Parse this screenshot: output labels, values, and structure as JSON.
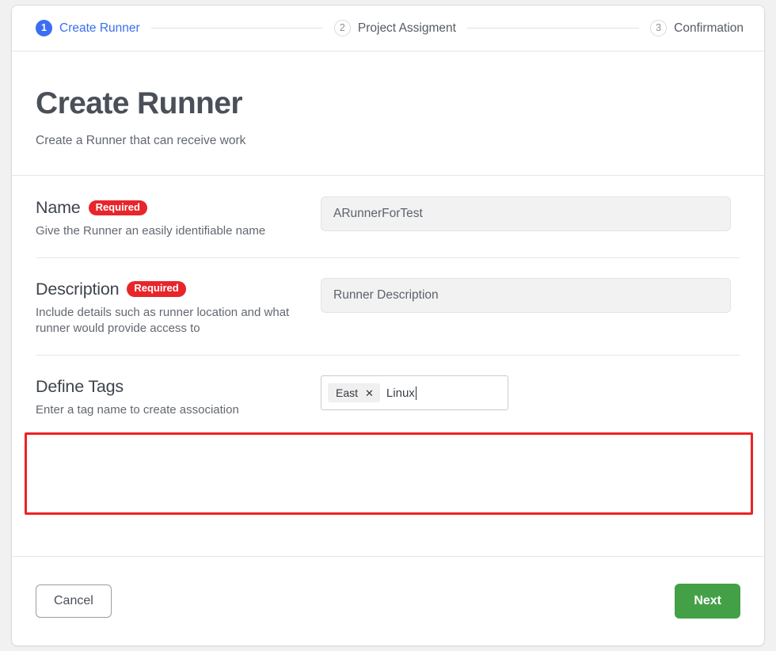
{
  "stepper": {
    "steps": [
      {
        "number": "1",
        "label": "Create Runner",
        "state": "active"
      },
      {
        "number": "2",
        "label": "Project Assigment",
        "state": "idle"
      },
      {
        "number": "3",
        "label": "Confirmation",
        "state": "idle"
      }
    ],
    "active_color": "#3b6ef0"
  },
  "header": {
    "title": "Create Runner",
    "subtitle": "Create a Runner that can receive work"
  },
  "form": {
    "rows": [
      {
        "label": "Name",
        "badge": "Required",
        "hint": "Give the Runner an easily identifiable name",
        "value": "ARunnerForTest"
      },
      {
        "label": "Description",
        "badge": "Required",
        "hint": "Include details such as runner location and what runner would provide access to",
        "value": "Runner Description"
      },
      {
        "label": "Define Tags",
        "badge": "",
        "hint": "Enter a tag name to create association",
        "chips": [
          {
            "text": "East",
            "remove_icon": "close-icon"
          }
        ],
        "typed_text": "Linux"
      }
    ],
    "badge_color": "#e8252a"
  },
  "highlight": {
    "color": "#ee2222",
    "target": "define-tags-row"
  },
  "footer": {
    "cancel_label": "Cancel",
    "next_label": "Next",
    "next_color": "#43a047"
  }
}
